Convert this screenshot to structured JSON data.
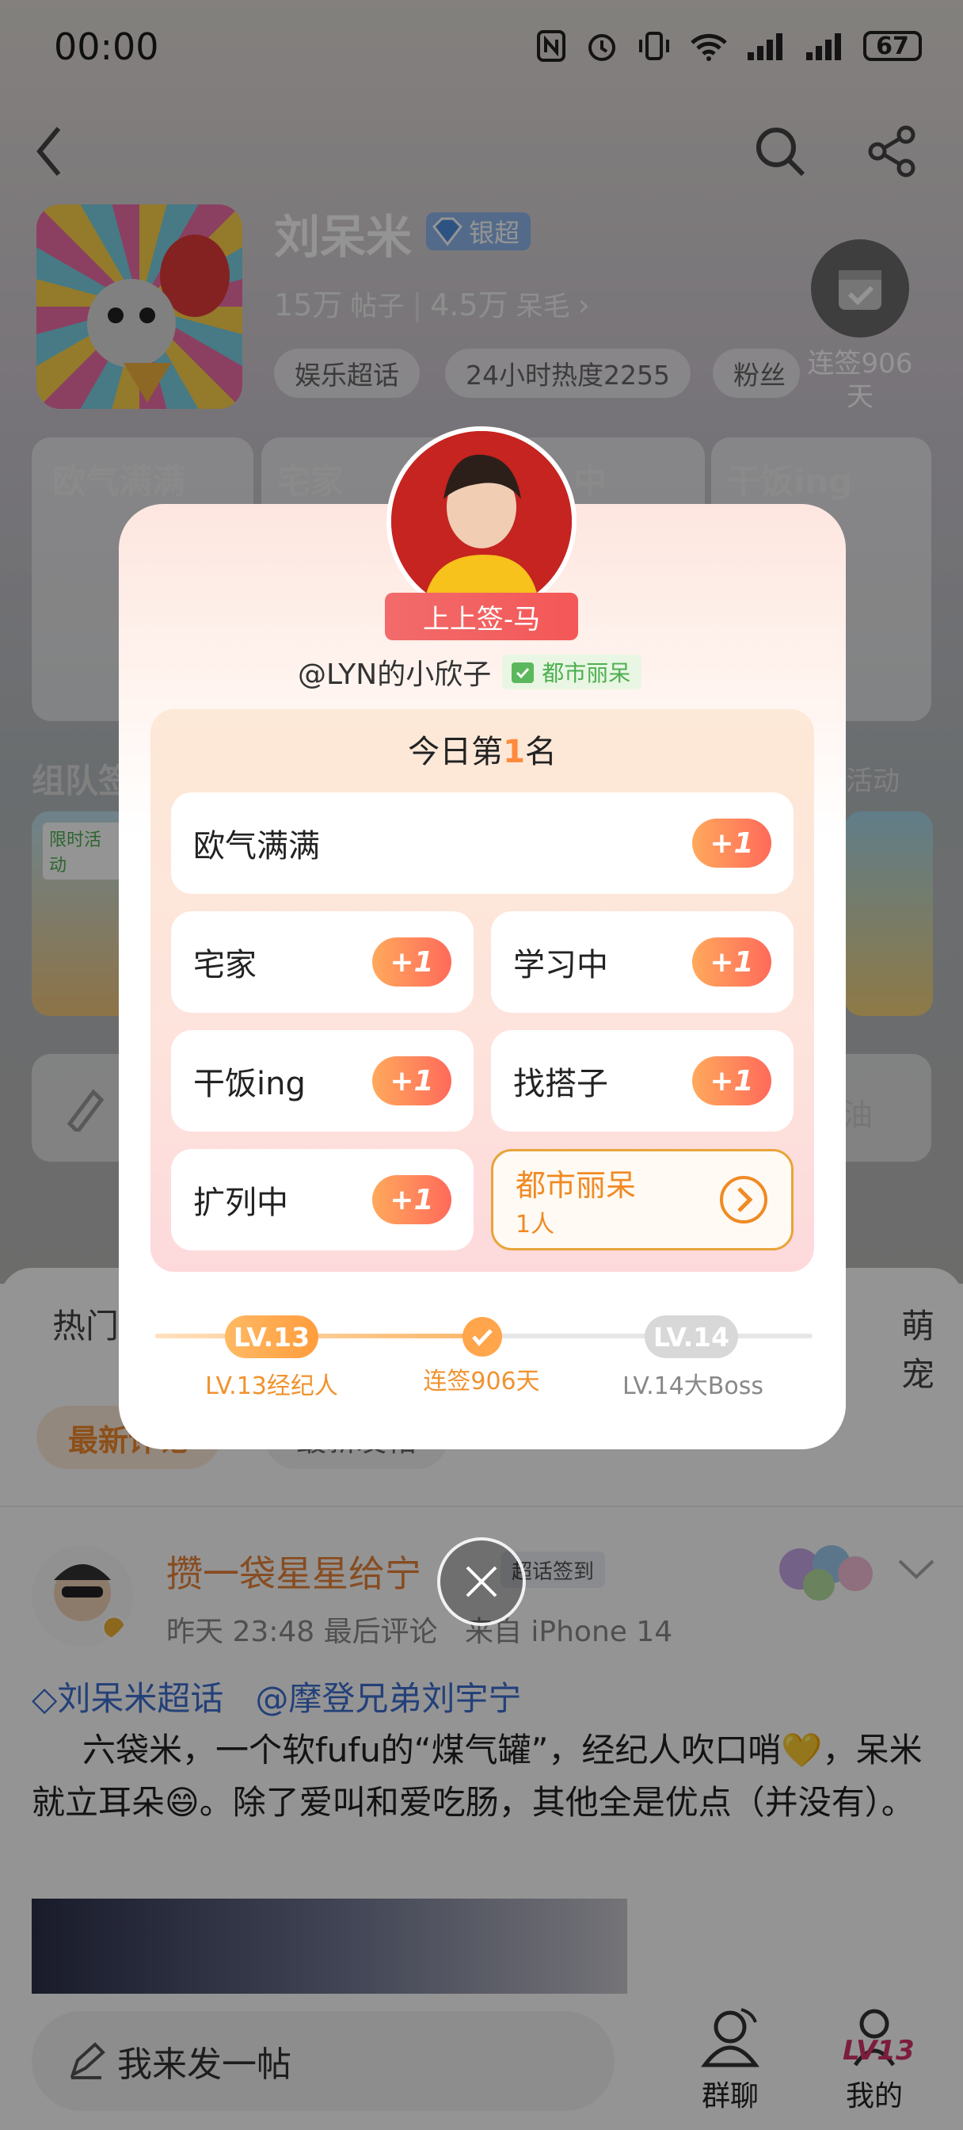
{
  "status_bar": {
    "time": "00:00",
    "battery": "67"
  },
  "header": {
    "name": "刘呆米",
    "badge": "银超",
    "stats": {
      "posts": "15万",
      "posts_label": "帖子",
      "fans": "4.5万",
      "fans_label": "呆毛"
    },
    "tags": [
      "娱乐超话",
      "24小时热度2255",
      "粉丝"
    ],
    "checkin_label": "连签906天"
  },
  "background_cards": {
    "titles": [
      "欧气满满",
      "宅家",
      "中",
      "干饭ing"
    ],
    "section_title": "组队签",
    "more_label": "活动",
    "promo_badge": "限时活动",
    "row_end_text": "油",
    "feed_tab_left": "热门",
    "feed_tab_right": "萌宠",
    "sort_active": "最新评论",
    "sort_other": "最新发帖"
  },
  "post": {
    "author": "攒一袋星星给宁",
    "tag": "超话签到",
    "meta": "昨天 23:48 最后评论   来自 iPhone 14",
    "topic_link": "刘呆米超话",
    "mention": "@摩登兄弟刘宇宁",
    "body": "六袋米，一个软fufu的“煤气罐”，经纪人吹口哨💛，呆米就立耳朵😄。除了爱叫和爱吃肠，其他全是优点（并没有）。"
  },
  "bottom_bar": {
    "compose_placeholder": "我来发一帖",
    "group_chat": "群聊",
    "mine": "我的",
    "level_badge": "LV13"
  },
  "modal": {
    "ribbon": "上上签-马",
    "username": "@LYN的小欣子",
    "user_tag": "都市丽呆",
    "rank_prefix": "今日第",
    "rank_number": "1",
    "rank_suffix": "名",
    "plus_label": "+1",
    "tiles": {
      "row1": "欧气满满",
      "row2_left": "宅家",
      "row2_right": "学习中",
      "row3_left": "干饭ing",
      "row3_right": "找搭子",
      "row4_left": "扩列中"
    },
    "special_tile": {
      "title": "都市丽呆",
      "count": "1人"
    },
    "progress": {
      "left_pill": "LV.13",
      "right_pill": "LV.14",
      "left_label": "LV.13经纪人",
      "mid_label": "连签906天",
      "right_label": "LV.14大Boss",
      "fraction": 0.5
    }
  },
  "colors": {
    "accent_orange": "#ff8a3d",
    "brand_green": "#5cb85c",
    "special_border": "#e8a43a"
  }
}
